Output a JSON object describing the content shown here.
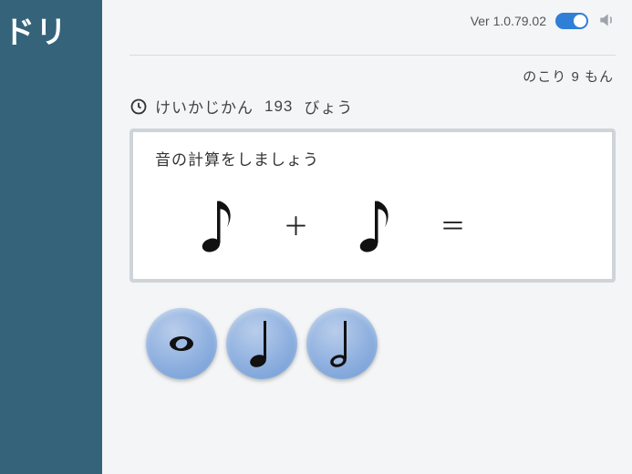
{
  "app": {
    "logo_text": "ドリ"
  },
  "header": {
    "version_label": "Ver 1.0.79.02",
    "toggle_on": true
  },
  "status": {
    "remaining_prefix": "のこり",
    "remaining_count": "9",
    "remaining_suffix": "もん"
  },
  "timer": {
    "label": "けいかじかん",
    "value": "193",
    "unit": "びょう"
  },
  "question": {
    "instruction": "音の計算をしましょう",
    "left_note": "eighth",
    "operator": "＋",
    "right_note": "eighth",
    "equals": "＝"
  },
  "answers": [
    {
      "id": "whole",
      "note": "whole"
    },
    {
      "id": "quarter",
      "note": "quarter"
    },
    {
      "id": "half",
      "note": "half"
    }
  ],
  "icons": {
    "clock": "clock-icon",
    "sound": "sound-icon",
    "toggle": "toggle-switch"
  }
}
